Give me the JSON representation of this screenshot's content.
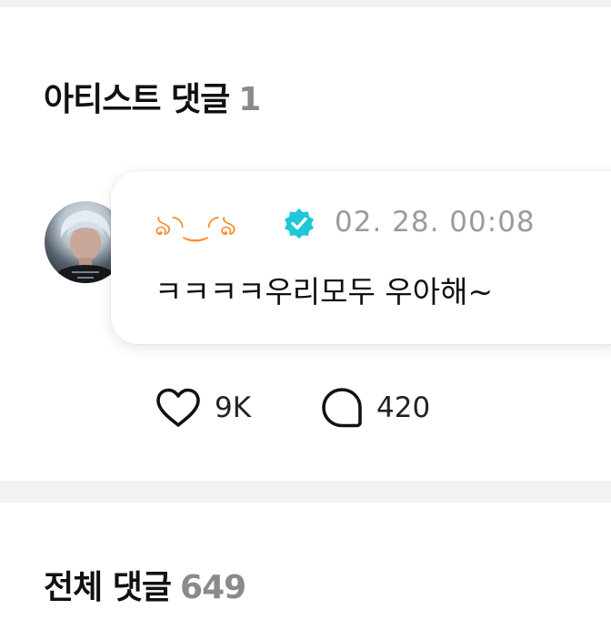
{
  "artist_comments": {
    "title": "아티스트 댓글",
    "count": "1",
    "comment": {
      "author": "ঌ◝‿◜ঌ",
      "author_color": "#ff8a2b",
      "verified_icon": "verified-badge-icon",
      "verified_color": "#1ec8d8",
      "timestamp": "02. 28. 00:08",
      "text": "ㅋㅋㅋㅋ우리모두 우아해~",
      "likes": "9K",
      "replies": "420"
    }
  },
  "all_comments": {
    "title": "전체 댓글",
    "count": "649"
  }
}
